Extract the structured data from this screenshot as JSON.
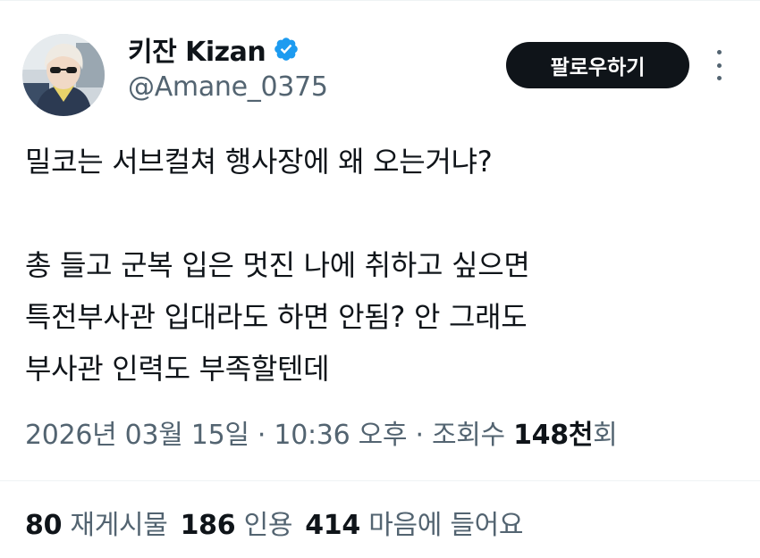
{
  "header": {
    "display_name": "키잔 Kizan",
    "handle": "@Amane_0375",
    "follow_label": "팔로우하기",
    "verified_icon": "verified-badge-icon",
    "accent_color": "#1d9bf0"
  },
  "tweet": {
    "lines": [
      "밀코는 서브컬쳐 행사장에 왜 오는거냐?",
      "총 들고 군복 입은 멋진 나에 취하고 싶으면",
      "특전부사관 입대라도 하면 안됨? 안 그래도",
      "부사관 인력도 부족할텐데"
    ]
  },
  "meta": {
    "date": "2026년 03월 15일",
    "time": "10:36 오후",
    "views_prefix": "조회수",
    "views_count": "148천",
    "views_suffix": "회"
  },
  "stats": {
    "reposts_count": "80",
    "reposts_label": "재게시물",
    "quotes_count": "186",
    "quotes_label": "인용",
    "likes_count": "414",
    "likes_label": "마음에 들어요"
  }
}
